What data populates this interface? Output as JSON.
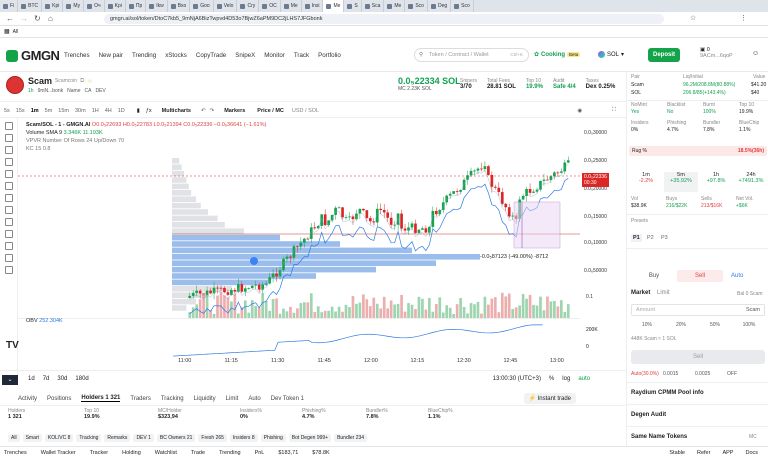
{
  "browser": {
    "tabs": [
      {
        "label": "Fi"
      },
      {
        "label": "BTC"
      },
      {
        "label": "Kpi"
      },
      {
        "label": "Му"
      },
      {
        "label": "Оч"
      },
      {
        "label": "Kpi"
      },
      {
        "label": "Пр"
      },
      {
        "label": "Ikw"
      },
      {
        "label": "Вхо"
      },
      {
        "label": "Goo"
      },
      {
        "label": "Velo"
      },
      {
        "label": "Cry"
      },
      {
        "label": "OC"
      },
      {
        "label": "Me"
      },
      {
        "label": "Insi"
      },
      {
        "label": "Me"
      },
      {
        "label": "S"
      },
      {
        "label": "Sca"
      },
      {
        "label": "Me"
      },
      {
        "label": "Sco"
      },
      {
        "label": "Deg"
      },
      {
        "label": "Sco"
      }
    ],
    "url": "gmgn.ai/sol/token/DtoC7kb5_9mNjA6BizTwpvd4D53o7BjwZ6aPM9DC2jLHS7JFGbonk",
    "bookmarks_label": "All"
  },
  "nav": {
    "logo": "GMGN",
    "links": [
      "Trenches",
      "New pair",
      "Trending",
      "xStocks",
      "CopyTrade",
      "SnipeX",
      "Monitor",
      "Track",
      "Portfolio"
    ],
    "search_placeholder": "Token / Contract / Wallet",
    "search_shortcut": "Ctrl+K",
    "cooking": "Cooking",
    "cooking_badge": "Beta",
    "chain": "SOL",
    "deposit": "Deposit",
    "balance": "0",
    "wallet": "9ACm...6qoP"
  },
  "token": {
    "name": "Scam",
    "subtitle": "Scamcoin",
    "age": "1h",
    "creator": "9mN...bonk",
    "tags": [
      "Name",
      "CA",
      "DEV"
    ],
    "price": "0.0₅22334 SOL",
    "mc": "MC 2.23K SOL",
    "stats": [
      {
        "label": "Snipers",
        "value": "3/70"
      },
      {
        "label": "Total Fees",
        "value": "28.81 SOL"
      },
      {
        "label": "Top 10",
        "value": "19.9%"
      },
      {
        "label": "Audit",
        "value": "Safe 4/4"
      },
      {
        "label": "Taxes",
        "value": "Dex 0.25%"
      }
    ]
  },
  "chart_toolbar": {
    "intervals": [
      "5s",
      "15s",
      "1m",
      "5m",
      "15m",
      "30m",
      "1H",
      "4H",
      "1D"
    ],
    "active": "1m",
    "multicharts": "Multicharts",
    "markers": "Markers",
    "price_mc": "Price / MC",
    "usd_sol": "USD / SOL"
  },
  "chart_legend": {
    "title": "Scam/SOL - 1 - GMGN.AI",
    "ohlc": "O0.0₅22693 H0.0₅22783 L0.0₅21394 C0.0₅22336 −0.0₆36641 (−1.61%)",
    "volume": "Volume SMA 9",
    "volume_vals": "3.346K 11.193K",
    "vpvr": "VPVR Number Of Rows 24 Up/Down 70",
    "kc": "KC 15 0.8"
  },
  "chart_data": {
    "type": "candlestick",
    "y_ticks": [
      "0.0₅30000",
      "0.0₅25000",
      "0.0₅20000",
      "0.0₅15000",
      "0.0₅10000",
      "0.0₆50000"
    ],
    "x_ticks": [
      "11:00",
      "11:15",
      "11:30",
      "11:45",
      "12:00",
      "12:15",
      "12:30",
      "12:45",
      "13:00"
    ],
    "current_price": "0.0₅22336",
    "current_countdown": "00:30",
    "measure_label": "-0.0₅87123 (-49.00%) -8712",
    "obv_label": "OBV",
    "obv_value": "252.304K",
    "obv_ticks": [
      "200K",
      "0"
    ],
    "volume_tick": "0.1"
  },
  "timeframes": {
    "ranges": [
      "1d",
      "7d",
      "30d",
      "180d"
    ],
    "clock": "13:00:30 (UTC+3)",
    "pct": "%",
    "log": "log",
    "auto": "auto"
  },
  "bottom_tabs": {
    "items": [
      "Activity",
      "Positions",
      "Holders 1 321",
      "Traders",
      "Tracking",
      "Liquidity",
      "Limit",
      "Auto",
      "Dev Token 1"
    ],
    "instant": "Instant trade"
  },
  "bottom_stats": [
    {
      "label": "Holders",
      "value": "1 321"
    },
    {
      "label": "Top 10",
      "value": "19.9%"
    },
    {
      "label": "MC/Holder",
      "value": "$323,94"
    },
    {
      "label": "Insiders%",
      "value": "0%"
    },
    {
      "label": "Phishing%",
      "value": "4.7%"
    },
    {
      "label": "Bundler%",
      "value": "7.8%"
    },
    {
      "label": "BlueChip%",
      "value": "1.1%"
    }
  ],
  "filters": [
    "All",
    "Smart",
    "KOL/VC 8",
    "Tracking",
    "Remarks",
    "DEV 1",
    "BC Owners 21",
    "Fresh 265",
    "Insiders 8",
    "Phishing",
    "Bot Degen 999+",
    "Bundler 234"
  ],
  "status_bar": [
    "Trenches",
    "Wallet Tracker",
    "Tracker",
    "Holding",
    "Watchlist",
    "Trade",
    "Trending",
    "PnL",
    "$183,71",
    "$78.8K"
  ],
  "status_right": [
    "Stable",
    "Refer",
    "APP",
    "Docs"
  ],
  "panel": {
    "pair_head": [
      "Pair",
      "Liq/Initial",
      "Value"
    ],
    "pair_rows": [
      [
        "Scam",
        "96.2M/208.8M(80.88%)",
        "$41.20"
      ],
      [
        "SOL",
        "206.8/85(+143.4%)",
        "$40"
      ]
    ],
    "safety": [
      {
        "label": "NoMint",
        "value": "Yes"
      },
      {
        "label": "Blacklist",
        "value": "No"
      },
      {
        "label": "Burnt",
        "value": "100%"
      },
      {
        "label": "Top 10",
        "value": "19.9%"
      },
      {
        "label": "Insiders",
        "value": "0%"
      },
      {
        "label": "Phishing",
        "value": "4.7%"
      },
      {
        "label": "Bundler",
        "value": "7.8%"
      },
      {
        "label": "BlueChip",
        "value": "1.1%"
      }
    ],
    "rug_label": "Rug %",
    "rug_value": "18.5%(36h)",
    "periods": [
      {
        "t": "1m",
        "v": "-2.2%"
      },
      {
        "t": "5m",
        "v": "+35.92%"
      },
      {
        "t": "1h",
        "v": "+97.8%"
      },
      {
        "t": "24h",
        "v": "+7491.3%"
      }
    ],
    "trade_stats": [
      {
        "label": "Vol",
        "value": "$38.9K"
      },
      {
        "label": "Buys",
        "value": "216/$22K"
      },
      {
        "label": "Sells",
        "value": "213/$16K"
      },
      {
        "label": "Net Vol.",
        "value": "+$6K"
      }
    ],
    "presets_label": "Presets",
    "presets": [
      "P1",
      "P2",
      "P3"
    ],
    "buy": "Buy",
    "sell": "Sell",
    "auto": "Auto",
    "order_types": [
      "Market",
      "Limit"
    ],
    "bal": "Bal 0 Scam",
    "amount_placeholder": "Amount",
    "amount_unit": "Scam",
    "pcts": [
      "10%",
      "20%",
      "50%",
      "100%"
    ],
    "est": "448K Scam ≈ 1 SOL",
    "sell_btn": "Sell",
    "auto_row": [
      "Auto(30.0%)",
      "0.0015",
      "0.0025",
      "OFF"
    ],
    "sections": [
      "Raydium CPMM Pool info",
      "Degen Audit",
      "Same Name Tokens"
    ],
    "section_extra": "MC"
  }
}
